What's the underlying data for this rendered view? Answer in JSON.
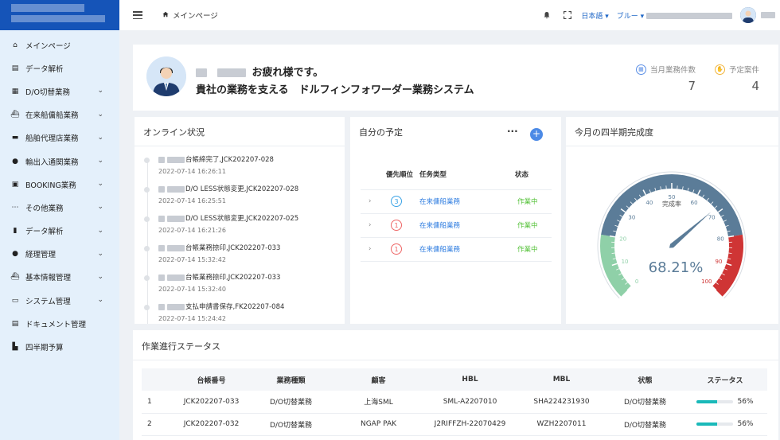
{
  "sidebar": {
    "items": [
      {
        "label": "メインページ",
        "icon": "home-icon",
        "has_children": false
      },
      {
        "label": "データ解析",
        "icon": "clipboard-icon",
        "has_children": false
      },
      {
        "label": "D/O切替業務",
        "icon": "grid-icon",
        "has_children": true
      },
      {
        "label": "在来船傭船業務",
        "icon": "ship-icon",
        "has_children": true
      },
      {
        "label": "船舶代理店業務",
        "icon": "truck-icon",
        "has_children": true
      },
      {
        "label": "輸出入通関業務",
        "icon": "user-icon",
        "has_children": true
      },
      {
        "label": "BOOKING業務",
        "icon": "booking-icon",
        "has_children": true
      },
      {
        "label": "その他業務",
        "icon": "dots-icon",
        "has_children": true
      },
      {
        "label": "データ解析",
        "icon": "bar-chart-icon",
        "has_children": true
      },
      {
        "label": "経理管理",
        "icon": "user-icon",
        "has_children": true
      },
      {
        "label": "基本情報管理",
        "icon": "ship-icon",
        "has_children": true
      },
      {
        "label": "システム管理",
        "icon": "monitor-icon",
        "has_children": true
      },
      {
        "label": "ドキュメント管理",
        "icon": "clipboard-icon",
        "has_children": false
      },
      {
        "label": "四半期予算",
        "icon": "budget-icon",
        "has_children": false
      }
    ]
  },
  "header": {
    "breadcrumb": "メインページ",
    "language": "日本語",
    "theme": "ブルー"
  },
  "welcome": {
    "greeting_suffix": "お疲れ様です。",
    "tagline": "貴社の業務を支える　ドルフィンフォワーダー業務システム",
    "stats": [
      {
        "label": "当月業務件数",
        "value": "7",
        "icon": "grid-icon",
        "color": "#5b8fe6"
      },
      {
        "label": "予定案件",
        "value": "4",
        "icon": "hand-icon",
        "color": "#f2b53a"
      }
    ]
  },
  "online": {
    "title": "オンライン状況",
    "items": [
      {
        "text": "台帳締完了,JCK202207-028",
        "time": "2022-07-14 16:26:11"
      },
      {
        "text": "D/O LESS状態変更,JCK202207-028",
        "time": "2022-07-14 16:25:51"
      },
      {
        "text": "D/O LESS状態変更,JCK202207-025",
        "time": "2022-07-14 16:21:26"
      },
      {
        "text": "台帳業務捺印,JCK202207-033",
        "time": "2022-07-14 15:32:42"
      },
      {
        "text": "台帳業務捺印,JCK202207-033",
        "time": "2022-07-14 15:32:40"
      },
      {
        "text": "支払申請書保存,FK202207-084",
        "time": "2022-07-14 15:24:42"
      }
    ]
  },
  "schedule": {
    "title": "自分の予定",
    "columns": [
      "優先順位",
      "任务类型",
      "状态"
    ],
    "rows": [
      {
        "priority": "3",
        "type": "在来傭船業務",
        "status": "作業中",
        "level": "blue"
      },
      {
        "priority": "1",
        "type": "在来傭船業務",
        "status": "作業中",
        "level": "red"
      },
      {
        "priority": "1",
        "type": "在来傭船業務",
        "status": "作業中",
        "level": "red"
      }
    ]
  },
  "gauge": {
    "title": "今月の四半期完成度",
    "center_label": "完成率",
    "value": 68.21,
    "value_text": "68.21%",
    "ticks": [
      "0",
      "10",
      "20",
      "30",
      "40",
      "50",
      "60",
      "70",
      "80",
      "90",
      "100"
    ],
    "colors": {
      "green": "#8fd0a8",
      "blue": "#5b7c98",
      "red": "#cf3535",
      "pointer": "#5b7c98",
      "value": "#5b7c98"
    }
  },
  "progress": {
    "title": "作業進行ステータス",
    "columns": [
      "",
      "台帳番号",
      "業務種類",
      "顧客",
      "HBL",
      "MBL",
      "状態",
      "ステータス"
    ],
    "rows": [
      {
        "no": "1",
        "ledger": "JCK202207-033",
        "kind": "D/O切替業務",
        "customer": "上海SML",
        "hbl": "SML-A2207010",
        "mbl": "SHA224231930",
        "state": "D/O切替業務",
        "percent": 56,
        "percent_text": "56%"
      },
      {
        "no": "2",
        "ledger": "JCK202207-032",
        "kind": "D/O切替業務",
        "customer": "NGAP PAK",
        "hbl": "J2RIFFZH-22070429",
        "mbl": "WZH2207011",
        "state": "D/O切替業務",
        "percent": 56,
        "percent_text": "56%"
      }
    ]
  }
}
